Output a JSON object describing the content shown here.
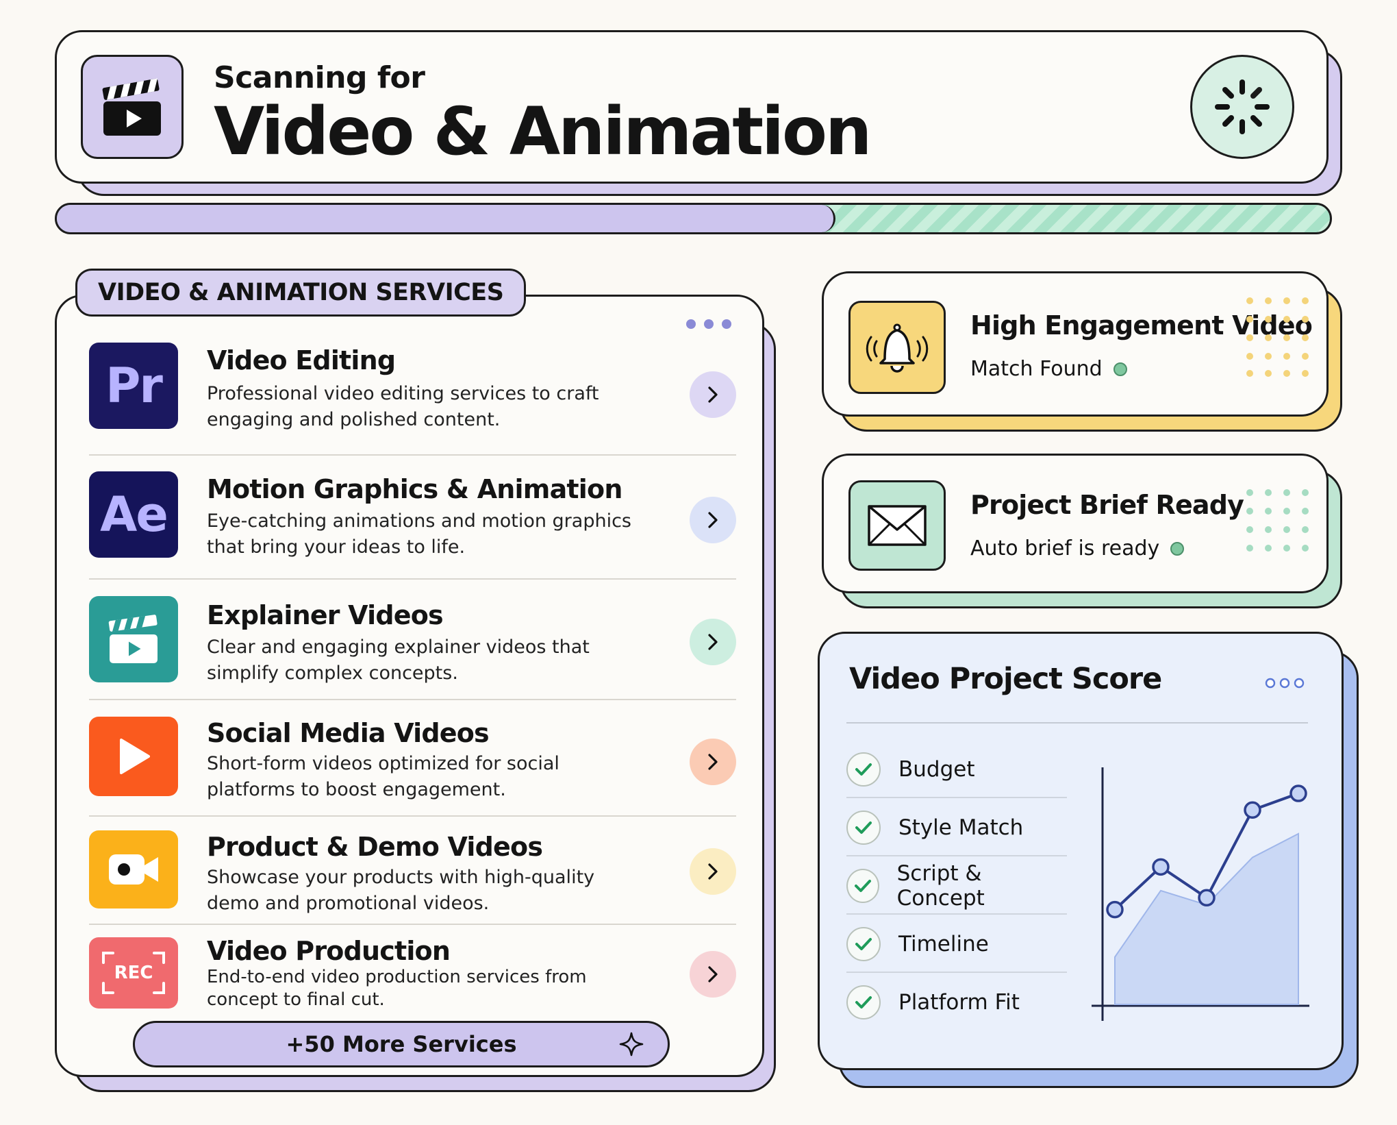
{
  "header": {
    "kicker": "Scanning for",
    "title": "Video & Animation"
  },
  "progress": {
    "fraction": 0.61,
    "colors": {
      "done": "#cdc5ee",
      "remaining": "#a8e2c8"
    }
  },
  "services": {
    "tab_label": "VIDEO & ANIMATION SERVICES",
    "items": [
      {
        "icon": "premiere-pro-icon",
        "icon_text": "Pr",
        "title": "Video Editing",
        "desc": "Professional video editing services to craft engaging and polished content.",
        "color": "#1b1860",
        "chev_bg": "#ddd7f4"
      },
      {
        "icon": "after-effects-icon",
        "icon_text": "Ae",
        "title": "Motion Graphics & Animation",
        "desc": "Eye-catching animations and motion graphics that bring your ideas to life.",
        "color": "#15145a",
        "chev_bg": "#dbe2f8"
      },
      {
        "icon": "clapperboard-icon",
        "icon_text": "",
        "title": "Explainer Videos",
        "desc": "Clear and engaging explainer videos that simplify complex concepts.",
        "color": "#2a9c96",
        "chev_bg": "#cdeee0"
      },
      {
        "icon": "play-icon",
        "icon_text": "",
        "title": "Social Media Videos",
        "desc": "Short-form videos optimized for social platforms to boost engagement.",
        "color": "#fa5a1e",
        "chev_bg": "#fbcbb4"
      },
      {
        "icon": "video-camera-icon",
        "icon_text": "",
        "title": "Product & Demo Videos",
        "desc": "Showcase your products with high-quality demo and promotional videos.",
        "color": "#fbb11a",
        "chev_bg": "#fbedc2"
      },
      {
        "icon": "rec-icon",
        "icon_text": "REC",
        "title": "Video Production",
        "desc": "End-to-end video production services from concept to final cut.",
        "color": "#f06a6e",
        "chev_bg": "#f7d3d6"
      }
    ],
    "more_label": "+50 More Services"
  },
  "alerts": [
    {
      "icon": "bell-icon",
      "title": "High Engagement Video",
      "subtitle": "Match Found",
      "accent": "#f7d77c"
    },
    {
      "icon": "envelope-icon",
      "title": "Project Brief Ready",
      "subtitle": "Auto brief is ready",
      "accent": "#bfe6d3"
    }
  ],
  "score": {
    "title": "Video Project Score",
    "checks": [
      "Budget",
      "Style Match",
      "Script & Concept",
      "Timeline",
      "Platform Fit"
    ],
    "accent": "#a9bff0"
  },
  "chart_data": {
    "type": "line",
    "x": [
      1,
      2,
      3,
      4,
      5
    ],
    "series": [
      {
        "values": [
          40,
          58,
          45,
          82,
          89
        ]
      },
      {
        "values": [
          20,
          48,
          42,
          62,
          72
        ]
      }
    ],
    "xlabel": "",
    "ylabel": "",
    "ylim": [
      0,
      100
    ],
    "grid": false
  }
}
